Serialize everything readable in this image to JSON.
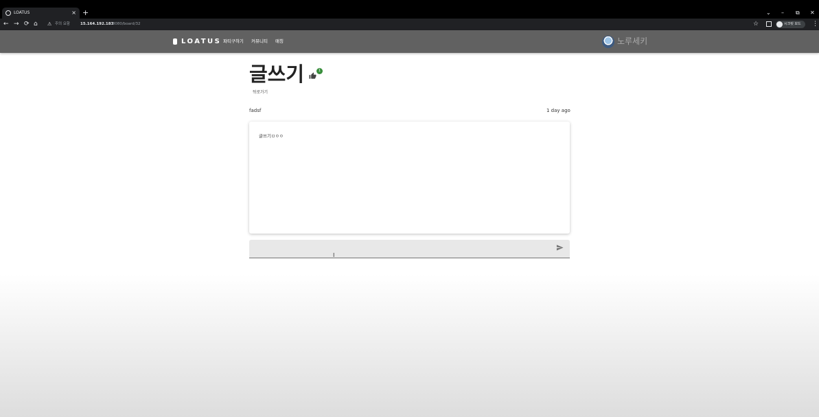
{
  "browser": {
    "tab_title": "LOATUS",
    "tab_close": "×",
    "new_tab": "+",
    "window_controls": [
      "⌄",
      "–",
      "⧉",
      "✕"
    ],
    "nav": {
      "back": "←",
      "forward": "→",
      "reload": "⟳",
      "home": "⌂"
    },
    "security_warning": "주의 요함",
    "url_host": "15.164.192.183",
    "url_path": ":8080/board/32",
    "profile_label": "시크릿 모드"
  },
  "app": {
    "brand": "LOATUS",
    "menu": [
      "파티구하기",
      "커뮤니티",
      "매칭"
    ],
    "user_name": "노루세키"
  },
  "post": {
    "title": "글쓰기",
    "like_count": "1",
    "back_link": "뒤로가기",
    "author": "fadsf",
    "timestamp": "1 day ago",
    "body": "글쓰기ㅁㅇㅇ"
  },
  "comment": {
    "placeholder": ""
  },
  "colors": {
    "appbar": "#616161",
    "badge": "#388e3c",
    "chrome": "#202124"
  },
  "icons": [
    "thumb-up-icon",
    "send-icon",
    "star-icon",
    "warning-icon"
  ]
}
